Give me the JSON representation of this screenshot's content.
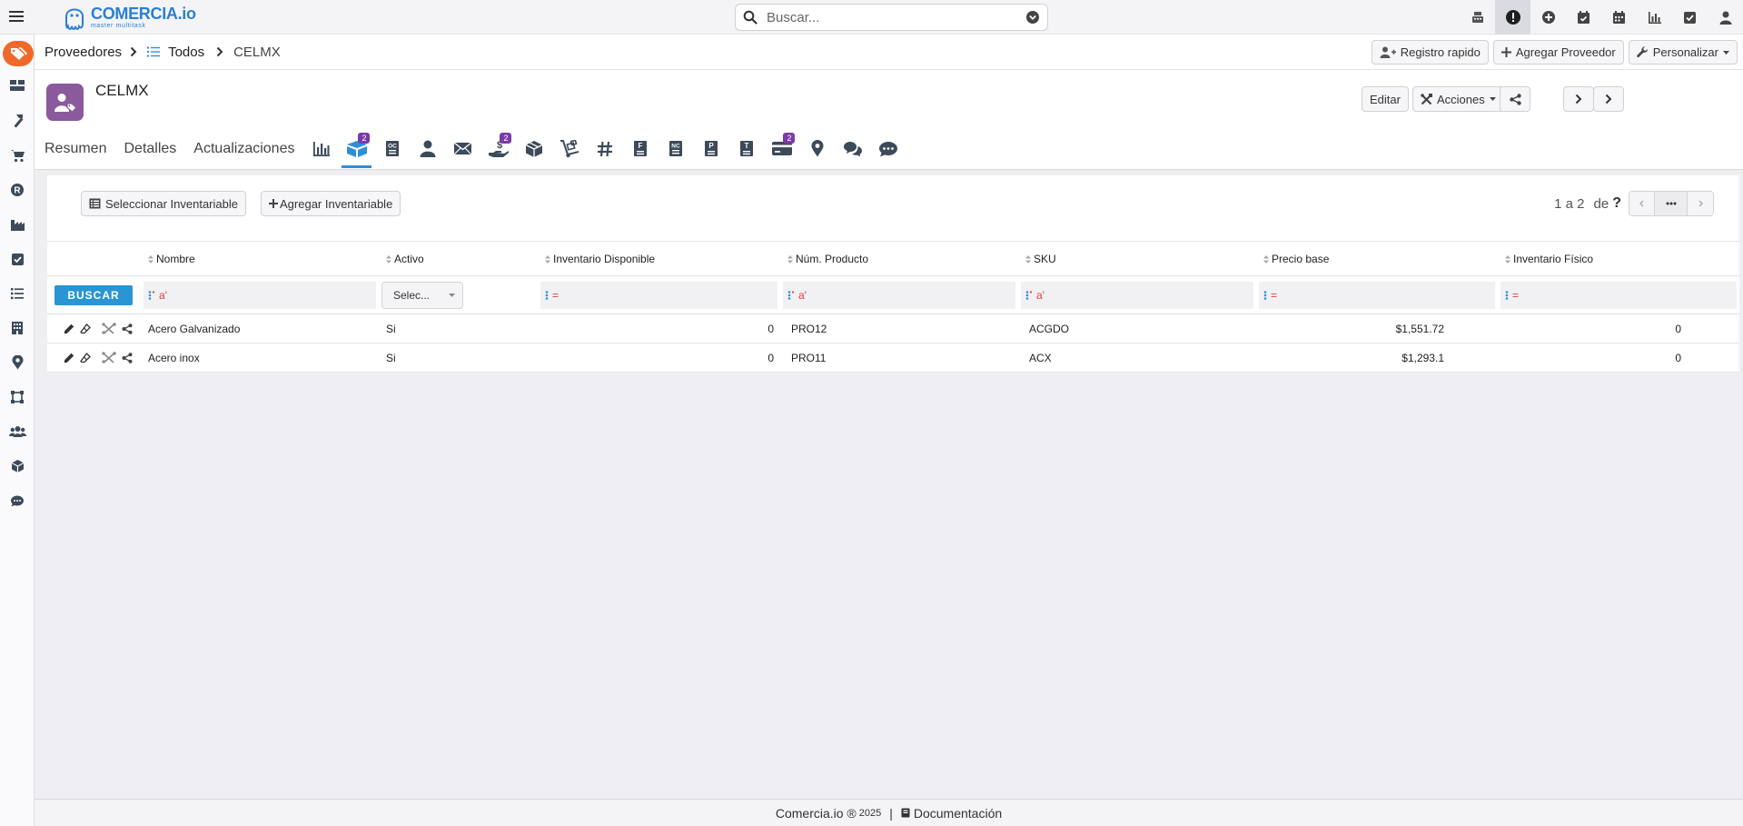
{
  "app": {
    "brand_name": "COMERCIA.io",
    "brand_tagline": "master multitask",
    "brand_color": "#2b7fd4"
  },
  "search": {
    "placeholder": "Buscar..."
  },
  "breadcrumb": {
    "root": "Proveedores",
    "list": "Todos",
    "current": "CELMX"
  },
  "header_actions": {
    "quick_register": "Registro rapido",
    "add_supplier": "Agregar Proveedor",
    "customize": "Personalizar"
  },
  "record": {
    "title": "CELMX",
    "edit_label": "Editar",
    "actions_label": "Acciones",
    "tabs": {
      "summary": "Resumen",
      "details": "Detalles",
      "updates": "Actualizaciones"
    },
    "badges": {
      "inventory": "2",
      "payments": "2",
      "cards": "2"
    },
    "accent_color": "#8a5a9c"
  },
  "toolbar": {
    "select_label": "Seleccionar Inventariable",
    "add_label": "Agregar Inventariable"
  },
  "pager": {
    "range": "1 a 2",
    "of_label": "de",
    "help": "?"
  },
  "table": {
    "columns": [
      "Nombre",
      "Activo",
      "Inventario Disponible",
      "Núm. Producto",
      "SKU",
      "Precio base",
      "Inventario Físico"
    ],
    "filter": {
      "search_label": "BUSCAR",
      "select_placeholder": "Selec...",
      "text_op": "a'",
      "num_op": "="
    },
    "rows": [
      [
        "Acero Galvanizado",
        "Si",
        "0",
        "PRO12",
        "ACGDO",
        "$1,551.72",
        "0"
      ],
      [
        "Acero inox",
        "Si",
        "0",
        "PRO11",
        "ACX",
        "$1,293.1",
        "0"
      ]
    ]
  },
  "footer": {
    "brand": "Comercia.io ®",
    "year": "2025",
    "separator": "|",
    "docs": "Documentación"
  }
}
